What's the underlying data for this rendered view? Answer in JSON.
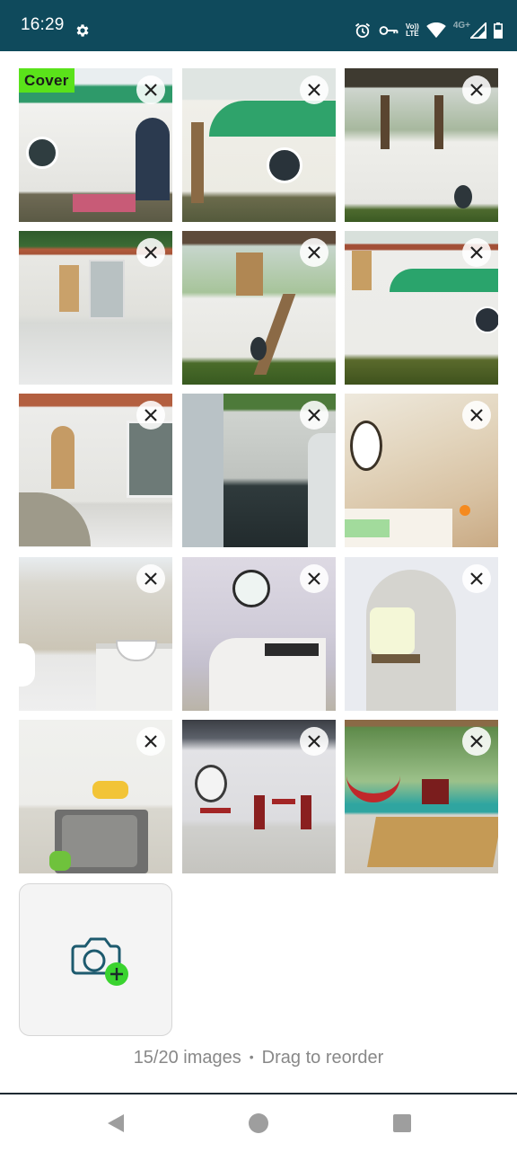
{
  "status_bar": {
    "time": "16:29",
    "volte_top": "Vo))",
    "volte_bottom": "LTE",
    "network": "4G+",
    "icons": [
      "gear-icon",
      "alarm-icon",
      "vpn-key-icon",
      "wifi-icon",
      "signal-icon",
      "battery-icon"
    ]
  },
  "gallery": {
    "cover_label": "Cover",
    "photos": [
      {
        "scene": "exterior-green-roof-round-window"
      },
      {
        "scene": "exterior-round-wall-with-window"
      },
      {
        "scene": "exterior-terrace-railing"
      },
      {
        "scene": "exterior-patio-tiles"
      },
      {
        "scene": "exterior-stairs-terrace"
      },
      {
        "scene": "exterior-side-green-roof"
      },
      {
        "scene": "exterior-patio-doors"
      },
      {
        "scene": "interior-corridor-view"
      },
      {
        "scene": "interior-bathroom-round-mirror"
      },
      {
        "scene": "interior-bathroom-sink"
      },
      {
        "scene": "interior-kitchen-round-window"
      },
      {
        "scene": "interior-bedroom-arch"
      },
      {
        "scene": "interior-kitchen-sink"
      },
      {
        "scene": "interior-dining-red-chairs"
      },
      {
        "scene": "terrace-hammock-bamboo"
      }
    ]
  },
  "add_photo": {
    "icon": "camera-add-icon",
    "accent_color": "#3ad32f"
  },
  "footer": {
    "count": "15/20 images",
    "separator": "•",
    "hint": "Drag to reorder"
  },
  "nav": {
    "back_icon": "back-triangle-icon",
    "home_icon": "home-circle-icon",
    "recents_icon": "recents-square-icon"
  },
  "colors": {
    "status_bar": "#0f4a5c",
    "cover_badge": "#5ae21a",
    "footer_text": "#888888"
  }
}
